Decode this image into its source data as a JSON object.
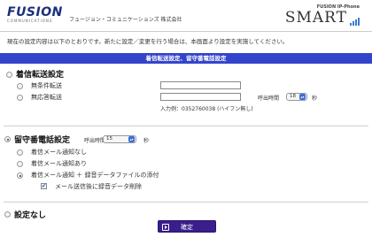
{
  "header": {
    "logo_word": "FUSION",
    "logo_sub": "COMMUNICATIONS",
    "company": "フュージョン・コミュニケーションズ 株式会社",
    "product_small": "FUSION IP-Phone",
    "product_big": "SMART"
  },
  "intro_text": "現在の設定内容は以下のとおりです。新たに設定／変更を行う場合は、本画面より設定を実施してください。",
  "section_bar": "着信転送設定、留守番電話設定",
  "forward": {
    "title": "着信転送設定",
    "unconditional_label": "無条件転送",
    "no_answer_label": "無応答転送",
    "call_time_label": "呼出時間",
    "call_time_value": "18",
    "seconds": "秒",
    "example": "入力例：0352760038 (ハイフン無し)"
  },
  "voicemail": {
    "title": "留守番電話設定",
    "call_time_label": "呼出時間",
    "call_time_value": "15",
    "seconds": "秒",
    "opt_no_mail": "着信メール通知なし",
    "opt_mail": "着信メール通知あり",
    "opt_mail_attach": "着信メール通知 ＋ 録音データファイルの添付",
    "delete_after_send": "メール送信後に録音データ削除"
  },
  "none": {
    "title": "設定なし"
  },
  "submit_label": "確定",
  "colors": {
    "accent_bar": "#3344cc",
    "button": "#3a1e8c"
  }
}
